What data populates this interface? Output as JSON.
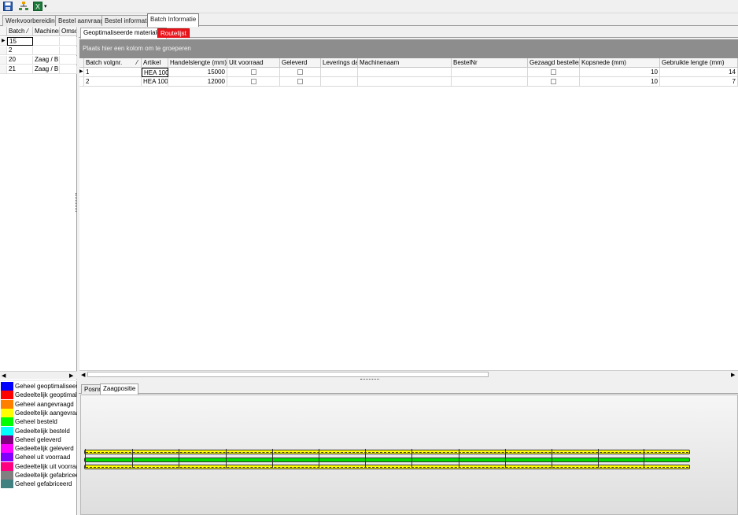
{
  "toolbar": {
    "icons": [
      "save-icon",
      "tree-icon",
      "excel-icon",
      "dropdown-icon"
    ]
  },
  "main_tabs": [
    "Werkvoorbereiding",
    "Bestel aanvraag",
    "Bestel informatie",
    "Batch Informatie"
  ],
  "batches": {
    "headers": [
      "Batch",
      "Machiner",
      "Omsc"
    ],
    "rows": [
      {
        "batch": "15",
        "machine": ""
      },
      {
        "batch": "2",
        "machine": ""
      },
      {
        "batch": "20",
        "machine": "Zaag / B"
      },
      {
        "batch": "21",
        "machine": "Zaag / B"
      }
    ]
  },
  "sub_tabs": [
    "Geoptimaliseerde materialen",
    "Routelijst"
  ],
  "group_bar": "Plaats hier een kolom om te groeperen",
  "grid": {
    "headers": [
      "Batch volgnr.",
      "Artikel",
      "Handelslengte (mm)",
      "Uit voorraad",
      "Geleverd",
      "Leverings dat",
      "Machinenaam",
      "BestelNr",
      "Gezaagd bestellen",
      "Kopsnede (mm)",
      "Gebruikte lengte (mm)"
    ],
    "rows": [
      {
        "volgnr": "1",
        "artikel": "HEA  100",
        "lengte": "15000",
        "kopsnede": "10",
        "gebruikt": "14"
      },
      {
        "volgnr": "2",
        "artikel": "HEA  100",
        "lengte": "12000",
        "kopsnede": "10",
        "gebruikt": "7"
      }
    ]
  },
  "legend": [
    {
      "label": "Geheel geoptimaliseerd",
      "color": "#0000ff"
    },
    {
      "label": "Gedeeltelijk geoptimaliseerd",
      "color": "#ff0000"
    },
    {
      "label": "Geheel aangevraagd",
      "color": "#ff8000"
    },
    {
      "label": "Gedeeltelijk aangevraagd",
      "color": "#ffff00"
    },
    {
      "label": "Geheel besteld",
      "color": "#00ff00"
    },
    {
      "label": "Gedeeltelijk besteld",
      "color": "#00ffff"
    },
    {
      "label": "Geheel geleverd",
      "color": "#800080"
    },
    {
      "label": "Gedeeltelijk geleverd",
      "color": "#ff00ff"
    },
    {
      "label": "Geheel uit voorraad",
      "color": "#8000ff"
    },
    {
      "label": "Gedeeltelijk uit voorraad",
      "color": "#ff0080"
    },
    {
      "label": "Gedeeltelijk gefabriceerd",
      "color": "#808080"
    },
    {
      "label": "Geheel gefabriceerd",
      "color": "#408080"
    }
  ],
  "bottom_tabs": [
    "Posnr",
    "Zaagpositie"
  ],
  "colors": {
    "bar_yellow": "#ffff00",
    "bar_green": "#00dd00"
  }
}
